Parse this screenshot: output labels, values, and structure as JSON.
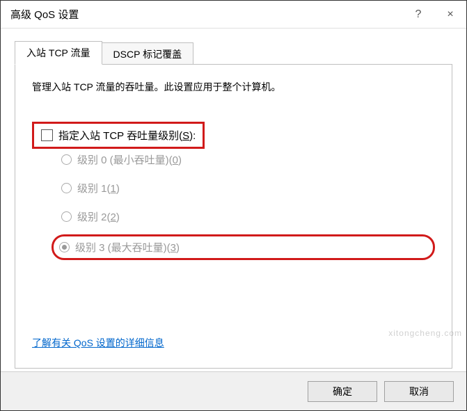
{
  "window": {
    "title": "高级 QoS 设置"
  },
  "titlebar": {
    "help": "?",
    "close": "×"
  },
  "tabs": {
    "active": "入站 TCP 流量",
    "inactive": "DSCP 标记覆盖"
  },
  "content": {
    "description": "管理入站 TCP 流量的吞吐量。此设置应用于整个计算机。",
    "checkbox_label_pre": "指定入站 TCP 吞吐量级别(",
    "checkbox_label_key": "S",
    "checkbox_label_post": "):",
    "checkbox_checked": false,
    "radios": [
      {
        "label_pre": "级别 0 (最小吞吐量)(",
        "key": "0",
        "label_post": ")",
        "selected": false
      },
      {
        "label_pre": "级别 1(",
        "key": "1",
        "label_post": ")",
        "selected": false
      },
      {
        "label_pre": "级别 2(",
        "key": "2",
        "label_post": ")",
        "selected": false
      },
      {
        "label_pre": "级别 3 (最大吞吐量)(",
        "key": "3",
        "label_post": ")",
        "selected": true
      }
    ],
    "link": "了解有关 QoS 设置的详细信息"
  },
  "footer": {
    "ok": "确定",
    "cancel": "取消"
  },
  "watermark": "xitongcheng.com",
  "colors": {
    "highlight": "#d11a1a",
    "link": "#0066cc"
  }
}
